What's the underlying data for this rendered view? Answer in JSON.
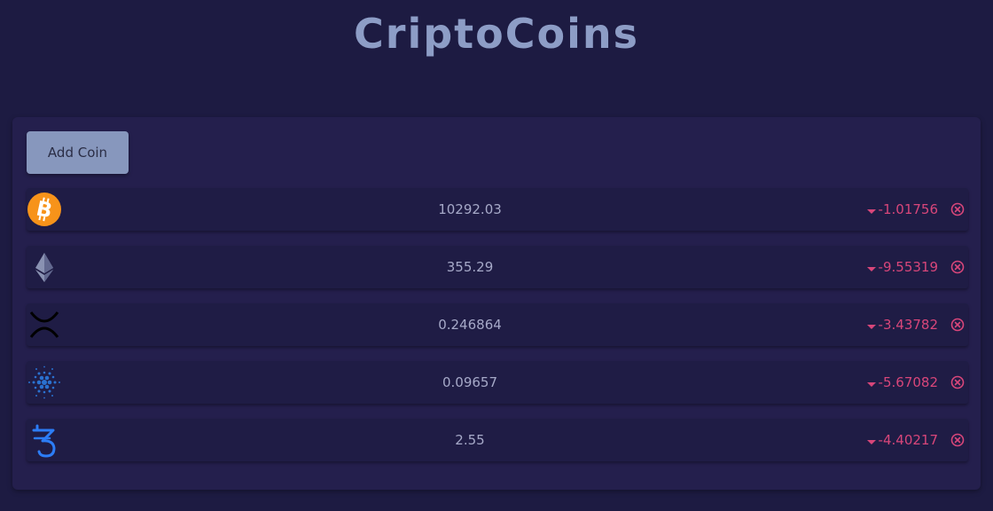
{
  "header": {
    "title": "CriptoCoins"
  },
  "toolbar": {
    "add_label": "Add Coin"
  },
  "coins": [
    {
      "icon": "bitcoin-icon",
      "price": "10292.03",
      "change": "-1.01756"
    },
    {
      "icon": "ethereum-icon",
      "price": "355.29",
      "change": "-9.55319"
    },
    {
      "icon": "xrp-icon",
      "price": "0.246864",
      "change": "-3.43782"
    },
    {
      "icon": "cardano-icon",
      "price": "0.09657",
      "change": "-5.67082"
    },
    {
      "icon": "tezos-icon",
      "price": "2.55",
      "change": "-4.40217"
    }
  ],
  "colors": {
    "background": "#1d1b42",
    "panel": "#241f4d",
    "accent": "#8797bd",
    "negative": "#d8467a"
  }
}
